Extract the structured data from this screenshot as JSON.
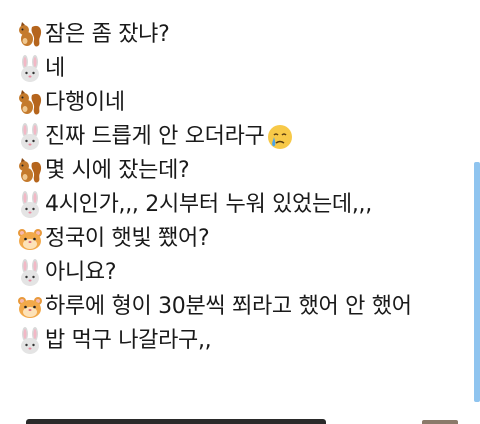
{
  "messages": [
    {
      "speaker": "squirrel",
      "icon": "squirrel-icon",
      "text": "잠은 좀 잤냐?"
    },
    {
      "speaker": "rabbit",
      "icon": "rabbit-icon",
      "text": "네"
    },
    {
      "speaker": "squirrel",
      "icon": "squirrel-icon",
      "text": "다행이네"
    },
    {
      "speaker": "rabbit",
      "icon": "rabbit-icon",
      "text": "진짜 드릅게 안 오더라구",
      "trailing_icon": "crying-face-icon"
    },
    {
      "speaker": "squirrel",
      "icon": "squirrel-icon",
      "text": "몇 시에 잤는데?"
    },
    {
      "speaker": "rabbit",
      "icon": "rabbit-icon",
      "text": "4시인가,,, 2시부터 누워 있었는데,,,"
    },
    {
      "speaker": "hamster",
      "icon": "hamster-icon",
      "text": "정국이 햇빛 쬈어?"
    },
    {
      "speaker": "rabbit",
      "icon": "rabbit-icon",
      "text": "아니요?"
    },
    {
      "speaker": "hamster",
      "icon": "hamster-icon",
      "text": "하루에 형이 30분씩 쬐라고 했어 안 했어"
    },
    {
      "speaker": "rabbit",
      "icon": "rabbit-icon",
      "text": "밥 먹구 나갈라구,,"
    }
  ],
  "colors": {
    "scroll_indicator": "#8fc4ef",
    "text": "#1a1a1a"
  }
}
